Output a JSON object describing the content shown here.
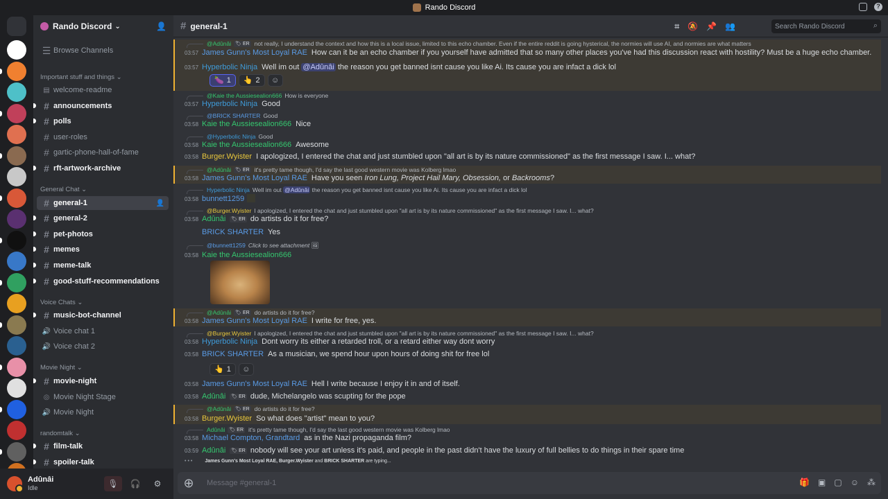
{
  "window": {
    "title": "Rando Discord"
  },
  "server": {
    "name": "Rando Discord",
    "dropdown": "⌄"
  },
  "sidebar": {
    "browse": "Browse Channels",
    "categories": [
      {
        "label": "Important stuff and things ⌄"
      },
      {
        "label": "General Chat ⌄"
      },
      {
        "label": "Voice Chats ⌄"
      },
      {
        "label": "Movie Night ⌄"
      },
      {
        "label": "randomtalk ⌄"
      }
    ],
    "channels": [
      {
        "name": "welcome-readme",
        "icon": "rules-icon",
        "glyph": "▤"
      },
      {
        "name": "announcements",
        "icon": "hash-icon",
        "glyph": "#"
      },
      {
        "name": "polls",
        "icon": "hash-icon",
        "glyph": "#"
      },
      {
        "name": "user-roles",
        "icon": "hash-icon",
        "glyph": "#"
      },
      {
        "name": "gartic-phone-hall-of-fame",
        "icon": "hash-icon",
        "glyph": "#"
      },
      {
        "name": "rft-artwork-archive",
        "icon": "hash-icon",
        "glyph": "#"
      },
      {
        "name": "general-1",
        "icon": "hash-icon",
        "glyph": "#"
      },
      {
        "name": "general-2",
        "icon": "hash-icon",
        "glyph": "#"
      },
      {
        "name": "pet-photos",
        "icon": "hash-icon",
        "glyph": "#"
      },
      {
        "name": "memes",
        "icon": "hash-icon",
        "glyph": "#"
      },
      {
        "name": "meme-talk",
        "icon": "hash-icon",
        "glyph": "#"
      },
      {
        "name": "good-stuff-recommendations",
        "icon": "hash-icon",
        "glyph": "#"
      },
      {
        "name": "music-bot-channel",
        "icon": "hash-icon",
        "glyph": "#"
      },
      {
        "name": "Voice chat 1",
        "icon": "speaker-icon",
        "glyph": "🔊"
      },
      {
        "name": "Voice chat 2",
        "icon": "speaker-icon",
        "glyph": "🔊"
      },
      {
        "name": "movie-night",
        "icon": "hash-icon",
        "glyph": "#"
      },
      {
        "name": "Movie Night Stage",
        "icon": "stage-icon",
        "glyph": "◎"
      },
      {
        "name": "Movie Night",
        "icon": "speaker-icon",
        "glyph": "🔊"
      },
      {
        "name": "film-talk",
        "icon": "hash-icon",
        "glyph": "#"
      },
      {
        "name": "spoiler-talk",
        "icon": "hash-icon",
        "glyph": "#"
      }
    ]
  },
  "guild_colors": [
    "#5865f2",
    "#ffffff",
    "#f08030",
    "#4ec0c8",
    "#c0405a",
    "#e07050",
    "#8a6a50",
    "#c8c8c8",
    "#d85838",
    "#5a3070",
    "#101010",
    "#3878c8",
    "#30a060",
    "#e8a020",
    "#8a7a50",
    "#2a6090",
    "#e890a8",
    "#e0e0e0",
    "#2060e0",
    "#c03030",
    "#606060",
    "#d07020",
    "#404040"
  ],
  "user": {
    "name": "Adûnâi",
    "status": "Idle",
    "mic": "🎙",
    "headset": "🎧",
    "settings": "⚙"
  },
  "channel": {
    "name": "general-1",
    "search_placeholder": "Search Rando Discord",
    "composer_placeholder": "Message #general-1"
  },
  "header_icons": [
    "threads-icon",
    "notifications-muted-icon",
    "pinned-icon",
    "members-icon"
  ],
  "messages": [
    {
      "reply_name": "@Adûnâi",
      "reply_tag": "🏷 ER",
      "reply_text": "not really, I understand the context and how this is a local issue, limited to this echo chamber. Even if the entire reddit is going hysterical, the normies will use AI, and normies are what matters",
      "time": "03:57",
      "author": "James Gunn's Most Loyal RAE",
      "text": "How can it be an echo chamber if you yourself have admitted that so many other places you've had this discussion react with hostility? Must be a huge echo chamber."
    },
    {
      "time": "03:57",
      "author": "Hyperbolic Ninja",
      "text_pre": "Well im out ",
      "mention": "@Adûnâi",
      "text_post": " the reason you get banned isnt cause you like Ai. Its cause you are infact a dick lol",
      "reactions": [
        {
          "emoji": "🍆",
          "count": "1"
        },
        {
          "emoji": "👆",
          "count": "2"
        }
      ]
    },
    {
      "reply_name": "@Kaie the Aussiesealion666",
      "reply_text": "How is everyone",
      "time": "03:57",
      "author": "Hyperbolic Ninja",
      "text": "Good"
    },
    {
      "reply_name": "@BRICK SHARTER",
      "reply_text": "Good",
      "time": "03:58",
      "author": "Kaie the Aussiesealion666",
      "text": "Nice"
    },
    {
      "reply_name": "@Hyperbolic Ninja",
      "reply_text": "Good",
      "time": "03:58",
      "author": "Kaie the Aussiesealion666",
      "text": "Awesome"
    },
    {
      "time": "03:58",
      "author": "Burger.Wyister",
      "text": "I apologized, I entered the chat and just stumbled upon \"all art is by its nature commissioned\" as the first message I saw. I... what?"
    },
    {
      "reply_name": "@Adûnâi",
      "reply_tag": "🏷 ER",
      "reply_text": "it's pretty tame though, I'd say the last good western movie was Kolberg lmao",
      "time": "03:58",
      "author": "James Gunn's Most Loyal RAE",
      "text_pre": "Have you seen ",
      "text_em": "Iron Lung, Project Hail Mary, Obsession,",
      "text_mid": " or ",
      "text_em2": "Backrooms",
      "text_post": "?"
    },
    {
      "reply_name": "Hyperbolic Ninja",
      "reply_text_pre": "Well im out ",
      "reply_mention": "@Adûnâi",
      "reply_text": "the reason you get banned isnt cause you like Ai. Its cause you are infact a dick lol",
      "time": "03:58",
      "author": "bunnett1259"
    },
    {
      "reply_name": "@Burger.Wyister",
      "reply_text": "I apologized, I entered the chat and just stumbled upon \"all art is by its nature commissioned\" as the first message I saw. I... what?",
      "time": "03:58",
      "author": "Adûnâi",
      "tag": "🏷 ER",
      "text": "do artists do it for free?"
    },
    {
      "time": "",
      "author": "BRICK SHARTER",
      "text": "Yes"
    },
    {
      "reply_name": "@bunnett1259",
      "reply_text": "Click to see attachment",
      "time": "03:58",
      "author": "Kaie the Aussiesealion666",
      "attachment": "shiba-image"
    },
    {
      "reply_name": "@Adûnâi",
      "reply_tag": "🏷 ER",
      "reply_text": "do artists do it for free?",
      "time": "03:58",
      "author": "James Gunn's Most Loyal RAE",
      "text": "I write for free, yes."
    },
    {
      "reply_name": "@Burger.Wyister",
      "reply_text": "I apologized, I entered the chat and just stumbled upon \"all art is by its nature commissioned\" as the first message I saw. I... what?",
      "time": "03:58",
      "author": "Hyperbolic Ninja",
      "text": "Dont worry its either a retarded troll, or a retard either way dont worry"
    },
    {
      "time": "03:58",
      "author": "BRICK SHARTER",
      "text": "As a musician, we spend hour upon hours of doing shit for free lol",
      "reactions": [
        {
          "emoji": "👆",
          "count": "1"
        }
      ]
    },
    {
      "time": "03:58",
      "author": "James Gunn's Most Loyal RAE",
      "text": "Hell I write because I enjoy it in and of itself."
    },
    {
      "time": "03:58",
      "author": "Adûnâi",
      "tag": "🏷 ER",
      "text": "dude, Michelangelo was scupting for the pope"
    },
    {
      "reply_name": "@Adûnâi",
      "reply_tag": "🏷 ER",
      "reply_text": "do artists do it for free?",
      "time": "03:58",
      "author": "Burger.Wyister",
      "text": "So what does \"artist\" mean to you?"
    },
    {
      "reply_name": "Adûnâi",
      "reply_tag": "🏷 ER",
      "reply_text": "it's pretty tame though, I'd say the last good western movie was Kolberg lmao",
      "time": "03:58",
      "author": "Michael Compton, Grandtard",
      "text": "as in the Nazi propaganda film?"
    },
    {
      "time": "03:59",
      "author": "Adûnâi",
      "tag": "🏷 ER",
      "text": "nobody will see your art unless it's paid, and people in the past didn't have the luxury of full bellies to do things in their spare time"
    }
  ],
  "typing": {
    "names": "James Gunn's Most Loyal RAE, Burger.Wyister",
    "and": "and",
    "last": "BRICK SHARTER",
    "suffix": "are typing..."
  },
  "add_reaction": "☺"
}
